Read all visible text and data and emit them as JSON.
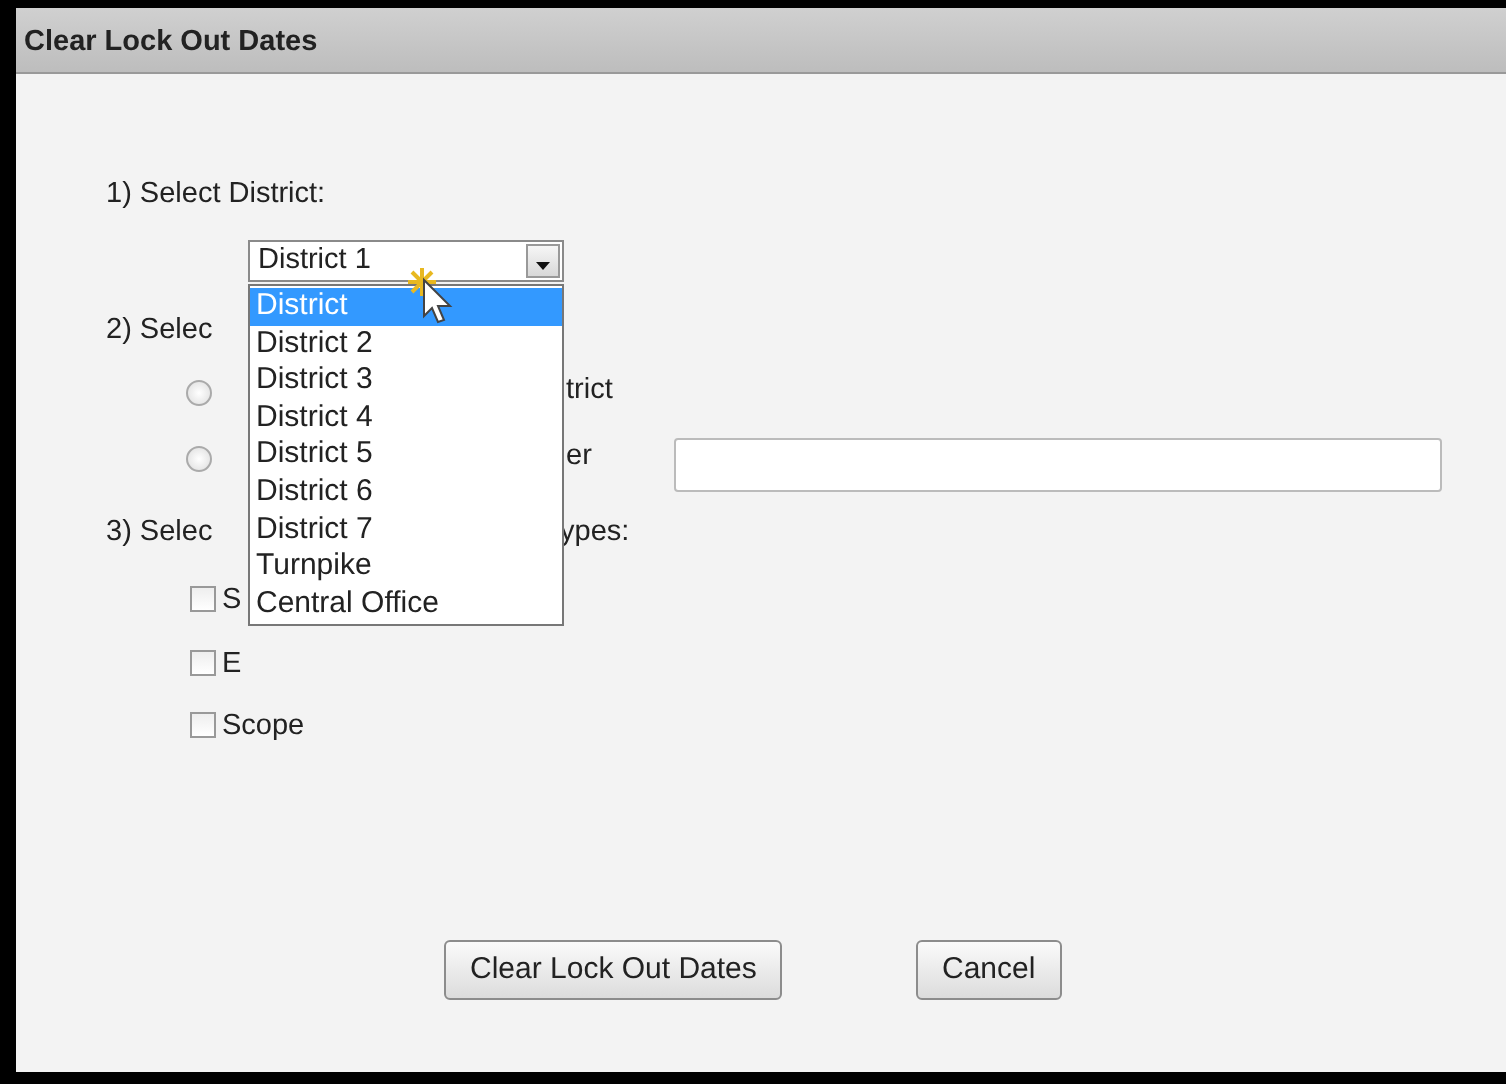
{
  "window": {
    "title": "Clear Lock Out Dates"
  },
  "district_step": {
    "label": "1) Select District:",
    "value": "District 1",
    "expanded": true,
    "options": [
      {
        "label": "District",
        "selected": true
      },
      {
        "label": "District 2",
        "selected": false
      },
      {
        "label": "District 3",
        "selected": false
      },
      {
        "label": "District 4",
        "selected": false
      },
      {
        "label": "District 5",
        "selected": false
      },
      {
        "label": "District 6",
        "selected": false
      },
      {
        "label": "District 7",
        "selected": false
      },
      {
        "label": "Turnpike",
        "selected": false
      },
      {
        "label": "Central Office",
        "selected": false
      }
    ]
  },
  "scope_step": {
    "label": "2) Selec",
    "options": [
      {
        "kind": "radio",
        "label": "trict",
        "selected": false
      },
      {
        "kind": "radio_with_field",
        "label": "er",
        "selected": false
      }
    ]
  },
  "types_step": {
    "label": "3) Selec",
    "label_tail": "ypes:",
    "types": [
      {
        "label": "S",
        "checked": false
      },
      {
        "label": "E",
        "checked": false
      },
      {
        "label": "Scope",
        "checked": false
      }
    ]
  },
  "buttons": [
    {
      "label": "Clear Lock Out Dates"
    },
    {
      "label": "Cancel"
    }
  ]
}
